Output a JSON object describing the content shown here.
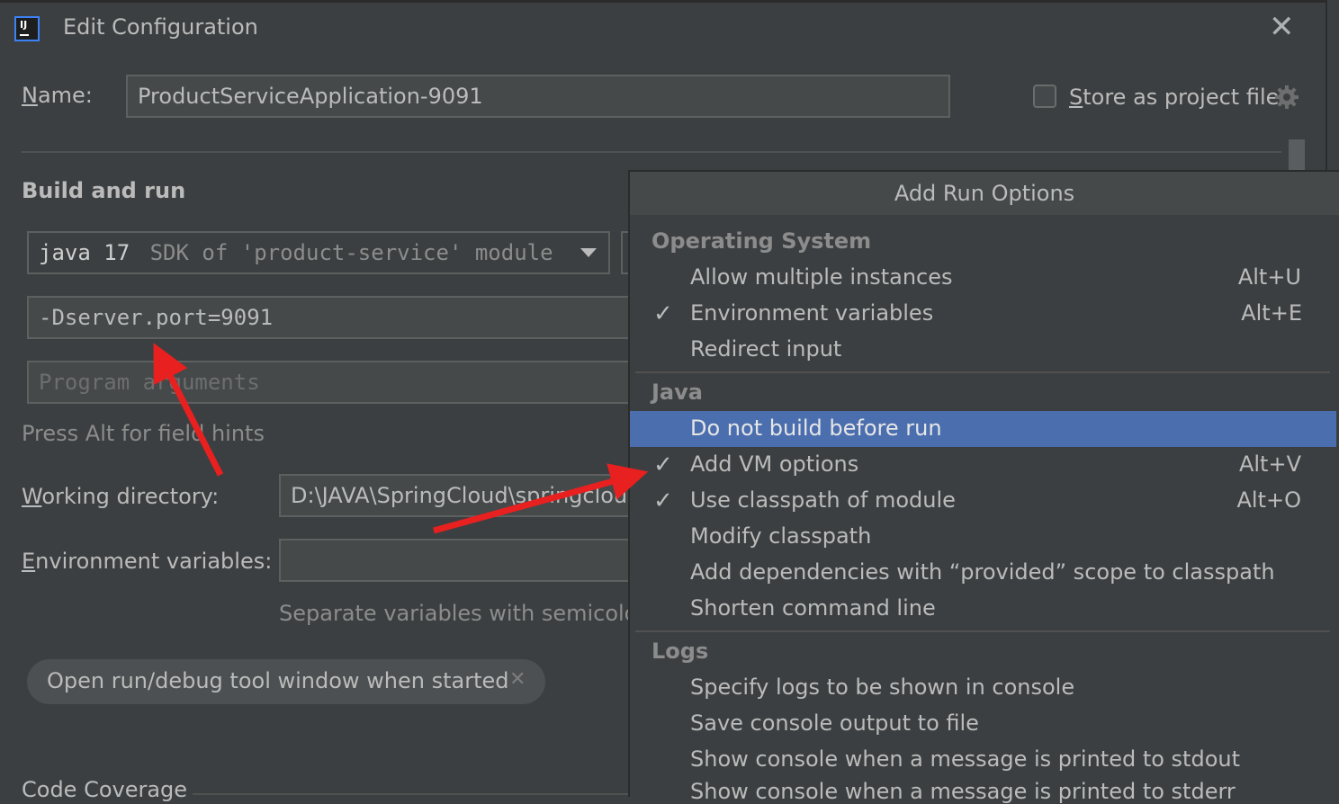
{
  "dialog": {
    "title": "Edit Configuration",
    "name_label": "Name:",
    "name_value": "ProductServiceApplication-9091",
    "store_label": "Store as project file",
    "store_checked": false
  },
  "build": {
    "section": "Build and run",
    "sdk_main": "java 17",
    "sdk_sub": "SDK of 'product-service' module",
    "vm_options": "-Dserver.port=9091",
    "program_args_placeholder": "Program arguments",
    "hint": "Press Alt for field hints",
    "working_dir_label": "Working directory:",
    "working_dir_value": "D:\\JAVA\\SpringCloud\\springclou",
    "env_label": "Environment variables:",
    "env_value": "",
    "env_hint": "Separate variables with semicolon",
    "chip": "Open run/debug tool window when started",
    "coverage": "Code Coverage"
  },
  "popup": {
    "title": "Add Run Options",
    "groups": [
      {
        "name": "Operating System"
      },
      {
        "name": "Java"
      },
      {
        "name": "Logs"
      }
    ],
    "items": [
      {
        "label": "Allow multiple instances",
        "shortcut": "Alt+U",
        "checked": false
      },
      {
        "label": "Environment variables",
        "shortcut": "Alt+E",
        "checked": true
      },
      {
        "label": "Redirect input",
        "shortcut": "",
        "checked": false
      },
      {
        "label": "Do not build before run",
        "shortcut": "",
        "checked": false,
        "selected": true
      },
      {
        "label": "Add VM options",
        "shortcut": "Alt+V",
        "checked": true
      },
      {
        "label": "Use classpath of module",
        "shortcut": "Alt+O",
        "checked": true
      },
      {
        "label": "Modify classpath",
        "shortcut": "",
        "checked": false
      },
      {
        "label": "Add dependencies with “provided” scope to classpath",
        "shortcut": "",
        "checked": false
      },
      {
        "label": "Shorten command line",
        "shortcut": "",
        "checked": false
      },
      {
        "label": "Specify logs to be shown in console",
        "shortcut": "",
        "checked": false
      },
      {
        "label": "Save console output to file",
        "shortcut": "",
        "checked": false
      },
      {
        "label": "Show console when a message is printed to stdout",
        "shortcut": "",
        "checked": false
      },
      {
        "label": "Show console when a message is printed to stderr",
        "shortcut": "",
        "checked": false
      }
    ]
  },
  "colors": {
    "background": "#3c3f41",
    "selection": "#4b6eaf",
    "annotation_arrow": "#e8201f"
  }
}
